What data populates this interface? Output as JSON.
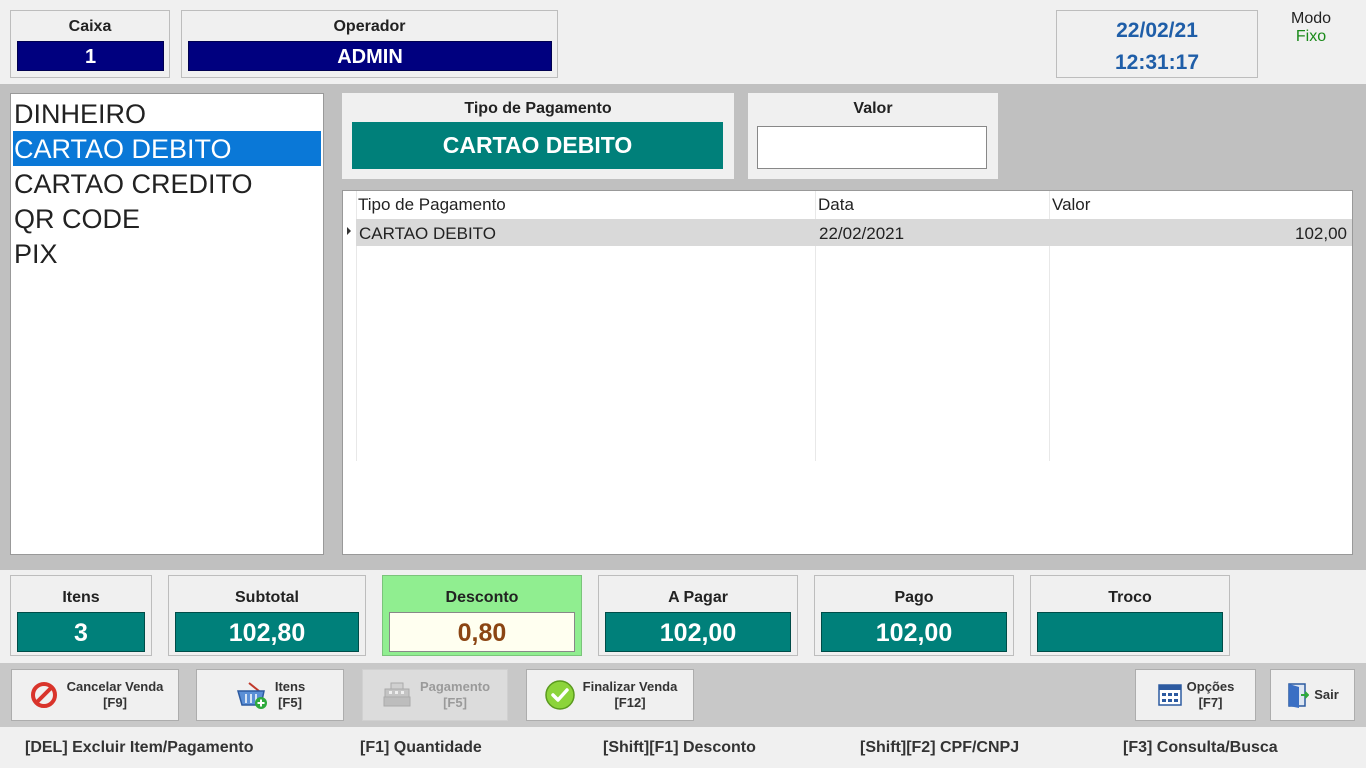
{
  "header": {
    "caixa_label": "Caixa",
    "caixa_value": "1",
    "operador_label": "Operador",
    "operador_value": "ADMIN",
    "date": "22/02/21",
    "time": "12:31:17",
    "modo_label": "Modo",
    "modo_value": "Fixo"
  },
  "payment_types": [
    {
      "label": "DINHEIRO",
      "selected": false
    },
    {
      "label": "CARTAO DEBITO",
      "selected": true
    },
    {
      "label": "CARTAO CREDITO",
      "selected": false
    },
    {
      "label": "QR CODE",
      "selected": false
    },
    {
      "label": "PIX",
      "selected": false
    }
  ],
  "tipo_pagamento": {
    "label": "Tipo de Pagamento",
    "value": "CARTAO DEBITO"
  },
  "valor": {
    "label": "Valor",
    "value": ""
  },
  "grid": {
    "columns": [
      "Tipo de Pagamento",
      "Data",
      "Valor"
    ],
    "rows": [
      {
        "tipo": "CARTAO DEBITO",
        "data": "22/02/2021",
        "valor": "102,00"
      }
    ]
  },
  "totals": {
    "itens": {
      "label": "Itens",
      "value": "3"
    },
    "subtotal": {
      "label": "Subtotal",
      "value": "102,80"
    },
    "desconto": {
      "label": "Desconto",
      "value": "0,80"
    },
    "a_pagar": {
      "label": "A Pagar",
      "value": "102,00"
    },
    "pago": {
      "label": "Pago",
      "value": "102,00"
    },
    "troco": {
      "label": "Troco",
      "value": ""
    }
  },
  "buttons": {
    "cancelar": {
      "label": "Cancelar Venda",
      "key": "[F9]"
    },
    "itens": {
      "label": "Itens",
      "key": "[F5]"
    },
    "pagamento": {
      "label": "Pagamento",
      "key": "[F5]"
    },
    "finalizar": {
      "label": "Finalizar Venda",
      "key": "[F12]"
    },
    "opcoes": {
      "label": "Opções",
      "key": "[F7]"
    },
    "sair": {
      "label": "Sair"
    }
  },
  "shortcuts": {
    "del": "[DEL] Excluir Item/Pagamento",
    "f1": "[F1] Quantidade",
    "shift_f1": "[Shift][F1] Desconto",
    "shift_f2": "[Shift][F2] CPF/CNPJ",
    "f3": "[F3] Consulta/Busca"
  },
  "colors": {
    "navy": "#00007f",
    "teal": "#00807a",
    "selection": "#0a78d7",
    "desconto_bg": "#90ee90"
  }
}
